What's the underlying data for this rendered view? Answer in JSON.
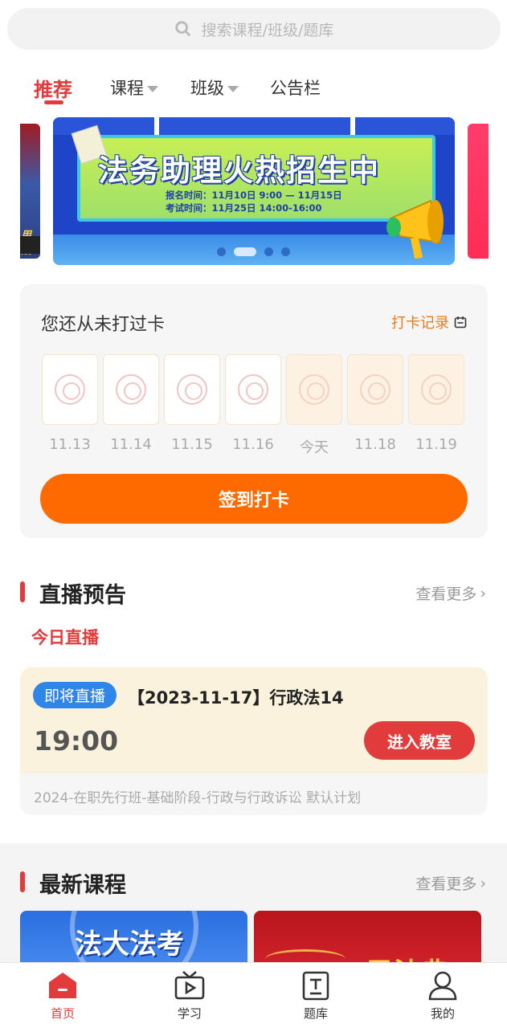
{
  "search": {
    "placeholder": "搜索课程/班级/题库"
  },
  "tabs": [
    {
      "label": "推荐",
      "active": true
    },
    {
      "label": "课程",
      "has_dropdown": true
    },
    {
      "label": "班级",
      "has_dropdown": true
    },
    {
      "label": "公告栏"
    }
  ],
  "banner": {
    "headline": "法务助理火热招生中",
    "line1": "报名时间：11月10日 9:00 — 11月15日",
    "line2": "考试时间：11月25日 14:00-16:00",
    "left_peek_text": "用法",
    "active_dot": 2,
    "dot_count": 4
  },
  "checkin": {
    "title": "您还从未打过卡",
    "record_label": "打卡记录",
    "days": [
      "11.13",
      "11.14",
      "11.15",
      "11.16",
      "今天",
      "11.18",
      "11.19"
    ],
    "button_label": "签到打卡"
  },
  "live_section": {
    "title": "直播预告",
    "more": "查看更多",
    "today_label": "今日直播",
    "card": {
      "badge": "即将直播",
      "title": "【2023-11-17】行政法14",
      "time": "19:00",
      "enter_label": "进入教室",
      "subtitle": "2024-在职先行班-基础阶段-行政与行政诉讼 默认计划"
    }
  },
  "newest_section": {
    "title": "最新课程",
    "more": "查看更多",
    "cards": [
      {
        "text": "法大法考"
      },
      {
        "text": "民法典"
      }
    ]
  },
  "bottom_nav": [
    {
      "label": "首页",
      "icon": "home-icon",
      "active": true
    },
    {
      "label": "学习",
      "icon": "video-icon"
    },
    {
      "label": "题库",
      "icon": "question-bank-icon"
    },
    {
      "label": "我的",
      "icon": "user-icon"
    }
  ],
  "colors": {
    "accent": "#e23b3b",
    "orange": "#ff6a00",
    "blue_badge": "#2f86e8",
    "record": "#e87c1a"
  }
}
